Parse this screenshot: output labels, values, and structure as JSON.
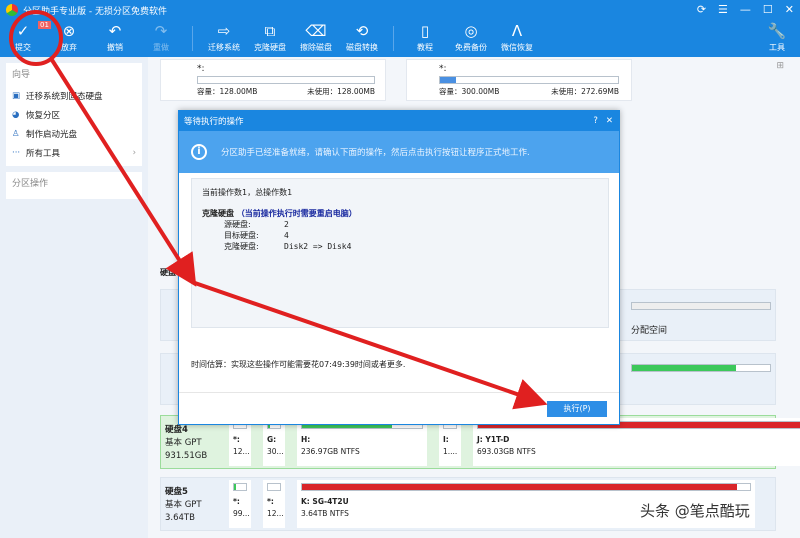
{
  "window": {
    "title": "分区助手专业版 - 无损分区免费软件",
    "controls": [
      "⟳",
      "☰",
      "—",
      "☐",
      "✕"
    ]
  },
  "toolbar": {
    "badge": "01",
    "items": [
      {
        "label": "提交",
        "icon": "✓"
      },
      {
        "label": "放弃",
        "icon": "⊗"
      },
      {
        "label": "撤销",
        "icon": "↶"
      },
      {
        "label": "重做",
        "icon": "↷"
      },
      {
        "label": "迁移系统",
        "icon": "⇨"
      },
      {
        "label": "克隆硬盘",
        "icon": "⧉"
      },
      {
        "label": "擦除磁盘",
        "icon": "⌫"
      },
      {
        "label": "磁盘转换",
        "icon": "⟲"
      },
      {
        "label": "教程",
        "icon": "▯"
      },
      {
        "label": "免费备份",
        "icon": "◎"
      },
      {
        "label": "微信恢复",
        "icon": "Λ"
      }
    ],
    "tools": {
      "label": "工具",
      "icon": "🔧"
    }
  },
  "sidebar": {
    "wizard_title": "向导",
    "items": [
      {
        "label": "迁移系统到固态硬盘",
        "icon": "▣"
      },
      {
        "label": "恢复分区",
        "icon": "◕"
      },
      {
        "label": "制作启动光盘",
        "icon": "♙"
      },
      {
        "label": "所有工具",
        "icon": "···"
      }
    ],
    "partition_ops_title": "分区操作"
  },
  "top_cards": [
    {
      "name": "*:",
      "capacity": "容量：128.00MB",
      "unused": "未使用：128.00MB",
      "used_pct": 0
    },
    {
      "name": "*:",
      "capacity": "容量：300.00MB",
      "unused": "未使用：272.69MB",
      "used_pct": 9
    }
  ],
  "disk_header": "硬盘",
  "row_fragments": {
    "unallocated": "分配空间"
  },
  "disks": [
    {
      "name": "硬盘4",
      "type": "基本 GPT",
      "size": "931.51GB",
      "partitions": [
        {
          "name": "*:",
          "info": "12..."
        },
        {
          "name": "G:",
          "info": "30..."
        },
        {
          "name": "H:",
          "info": "236.97GB NTFS",
          "pct": 75
        },
        {
          "name": "I:",
          "info": "1...."
        },
        {
          "name": "J: Y1T-D",
          "info": "693.03GB NTFS",
          "pct": 97
        }
      ]
    },
    {
      "name": "硬盘5",
      "type": "基本 GPT",
      "size": "3.64TB",
      "partitions": [
        {
          "name": "*:",
          "info": "99..."
        },
        {
          "name": "*:",
          "info": "12..."
        },
        {
          "name": "K: SG-4T2U",
          "info": "3.64TB NTFS",
          "pct": 97
        }
      ]
    }
  ],
  "dialog": {
    "title": "等待执行的操作",
    "info": "分区助手已经准备就绪，请确认下面的操作，然后点击执行按钮让程序正式地工作.",
    "count": "当前操作数1，总操作数1",
    "op_title": "克隆硬盘",
    "op_note": "（当前操作执行时需要重启电脑）",
    "rows": [
      {
        "k": "源硬盘:",
        "v": "2"
      },
      {
        "k": "目标硬盘:",
        "v": "4"
      },
      {
        "k": "克隆硬盘:",
        "v": "Disk2 => Disk4"
      }
    ],
    "estimate": "时间估算：实现这些操作可能需要花07:49:39时间或者更多.",
    "execute": "执行(P)"
  },
  "watermark": "头条 @笔点酷玩",
  "colors": {
    "accent": "#1a86e0",
    "used_red": "#d9252a",
    "used_green": "#3cc85a",
    "annotation": "#e02020"
  }
}
